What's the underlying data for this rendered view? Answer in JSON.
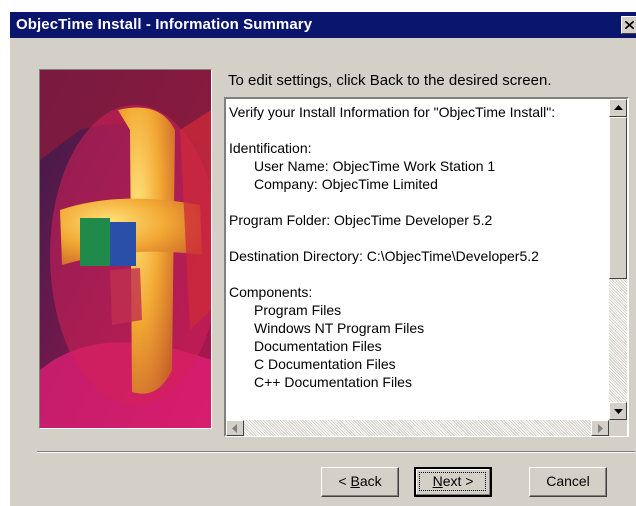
{
  "window": {
    "title": "ObjecTime Install - Information Summary"
  },
  "instruction": "To edit settings, click Back to the desired screen.",
  "summary": {
    "heading": "Verify your Install Information for \"ObjecTime Install\":",
    "identification_label": "Identification:",
    "user_name": "User Name: ObjecTime Work Station 1",
    "company": "Company: ObjecTime Limited",
    "program_folder": "Program Folder: ObjecTime Developer 5.2",
    "destination": "Destination Directory: C:\\ObjecTime\\Developer5.2",
    "components_label": "Components:",
    "components": [
      "Program Files",
      "Windows NT Program Files",
      "Documentation Files",
      "C Documentation Files",
      "C++ Documentation Files"
    ]
  },
  "buttons": {
    "back_prefix": "< ",
    "back_mnemonic": "B",
    "back_rest": "ack",
    "next_mnemonic": "N",
    "next_rest": "ext >",
    "cancel": "Cancel"
  },
  "colors": {
    "titlebar": "#0a166e",
    "dialog_bg": "#d4d0c8"
  }
}
